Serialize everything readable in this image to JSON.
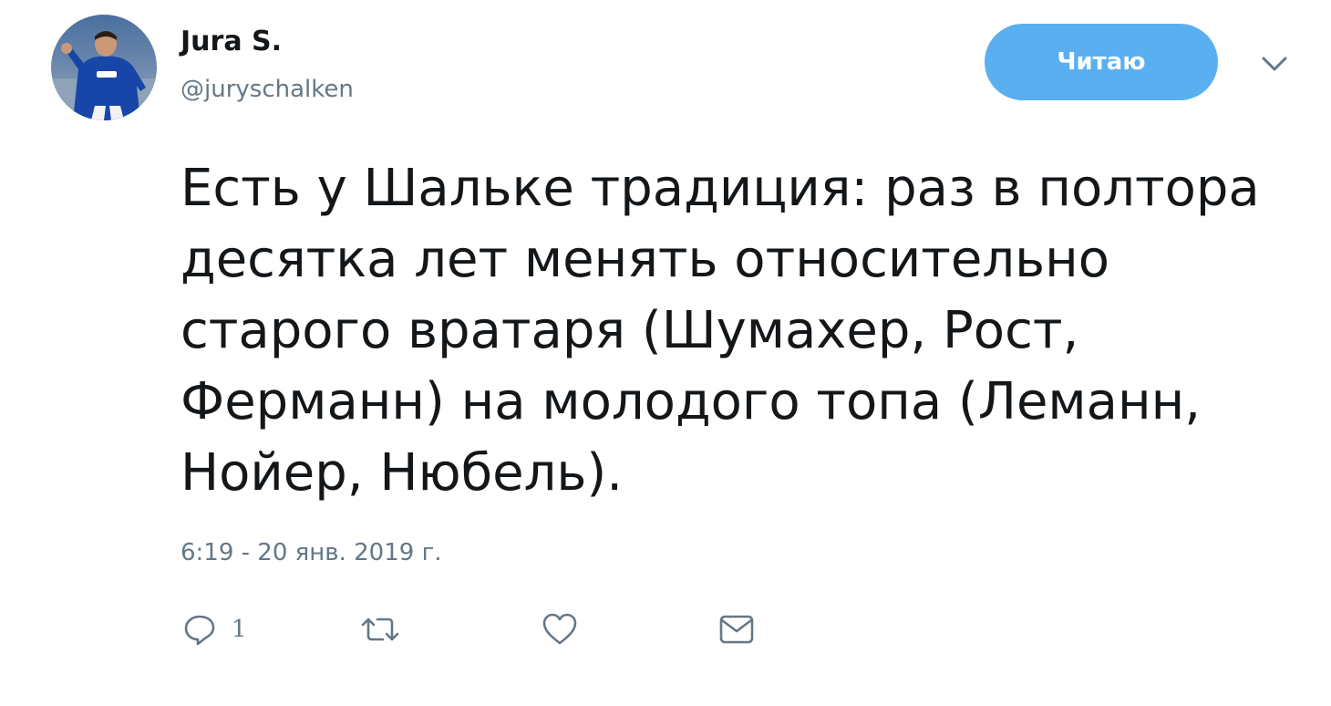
{
  "user": {
    "display_name": "Jura S.",
    "handle": "@juryschalken",
    "avatar_icon": "user-avatar"
  },
  "follow_button": {
    "label": "Читаю",
    "color": "#5aaff0"
  },
  "menu": {
    "icon": "chevron-down-icon"
  },
  "tweet": {
    "lines": [
      "Есть у Шальке традиция: раз в полтора",
      "десятка лет менять относительно",
      "старого вратаря (Шумахер, Рост,",
      "Ферманн) на молодого топа (Леманн,",
      "Нойер, Нюбель)."
    ],
    "timestamp": "6:19 - 20 янв. 2019 г."
  },
  "actions": {
    "reply": {
      "icon": "reply-icon",
      "count": "1"
    },
    "retweet": {
      "icon": "retweet-icon"
    },
    "like": {
      "icon": "heart-icon"
    },
    "dm": {
      "icon": "envelope-icon"
    }
  },
  "colors": {
    "text": "#14171a",
    "secondary": "#657786",
    "accent": "#1da1f2"
  }
}
